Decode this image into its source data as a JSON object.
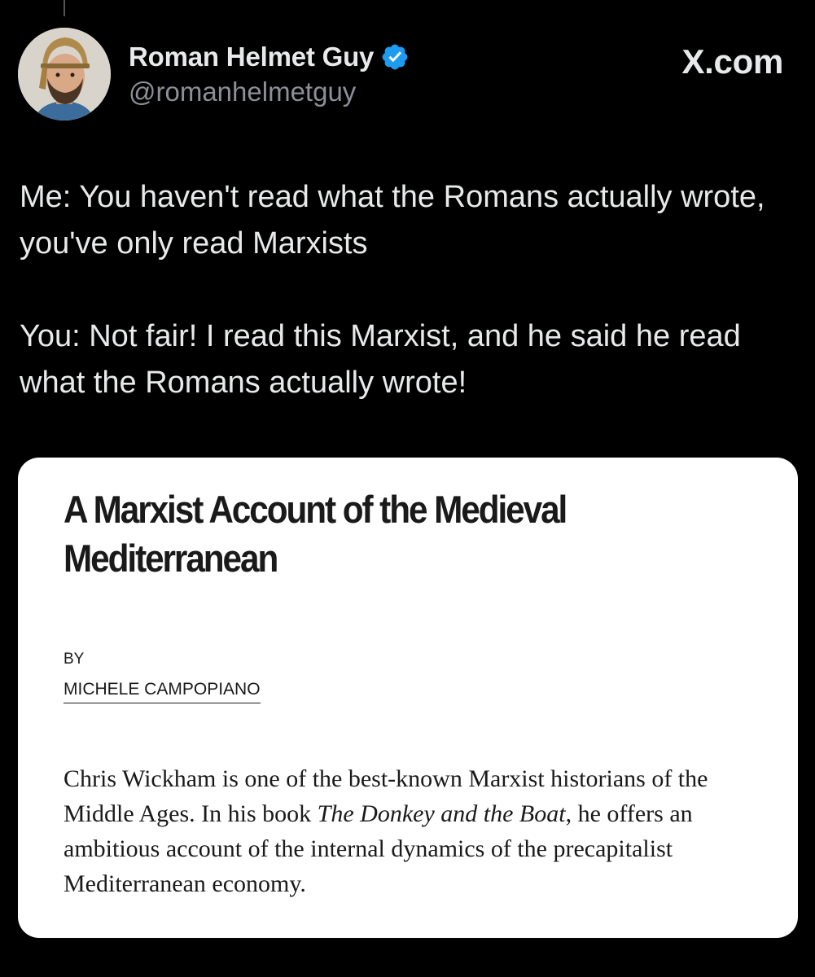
{
  "author": {
    "display_name": "Roman Helmet Guy",
    "handle": "@romanhelmetguy",
    "verified": true,
    "avatar_icon": "avatar-photo"
  },
  "site_label": "X.com",
  "tweet": {
    "paragraphs": [
      "Me: You haven't read what the Romans actually wrote, you've only read Marxists",
      "You: Not fair! I read this Marxist, and he said he read what the Romans actually wrote!"
    ]
  },
  "article": {
    "title": "A Marxist Account of the Medieval Mediterranean",
    "by_label": "BY",
    "author_name": "MICHELE CAMPOPIANO",
    "body_lead": "Chris Wickham is one of the best-known Marxist historians of the Middle Ages. In his book ",
    "body_book_title": "The Donkey and the Boat",
    "body_rest": ", he offers an ambitious account of the internal dynamics of the precapitalist Mediterranean economy."
  },
  "colors": {
    "background": "#000000",
    "text": "#e7e9ea",
    "handle": "#8b9096",
    "verified_blue": "#1d9bf0",
    "card_background": "#ffffff"
  }
}
